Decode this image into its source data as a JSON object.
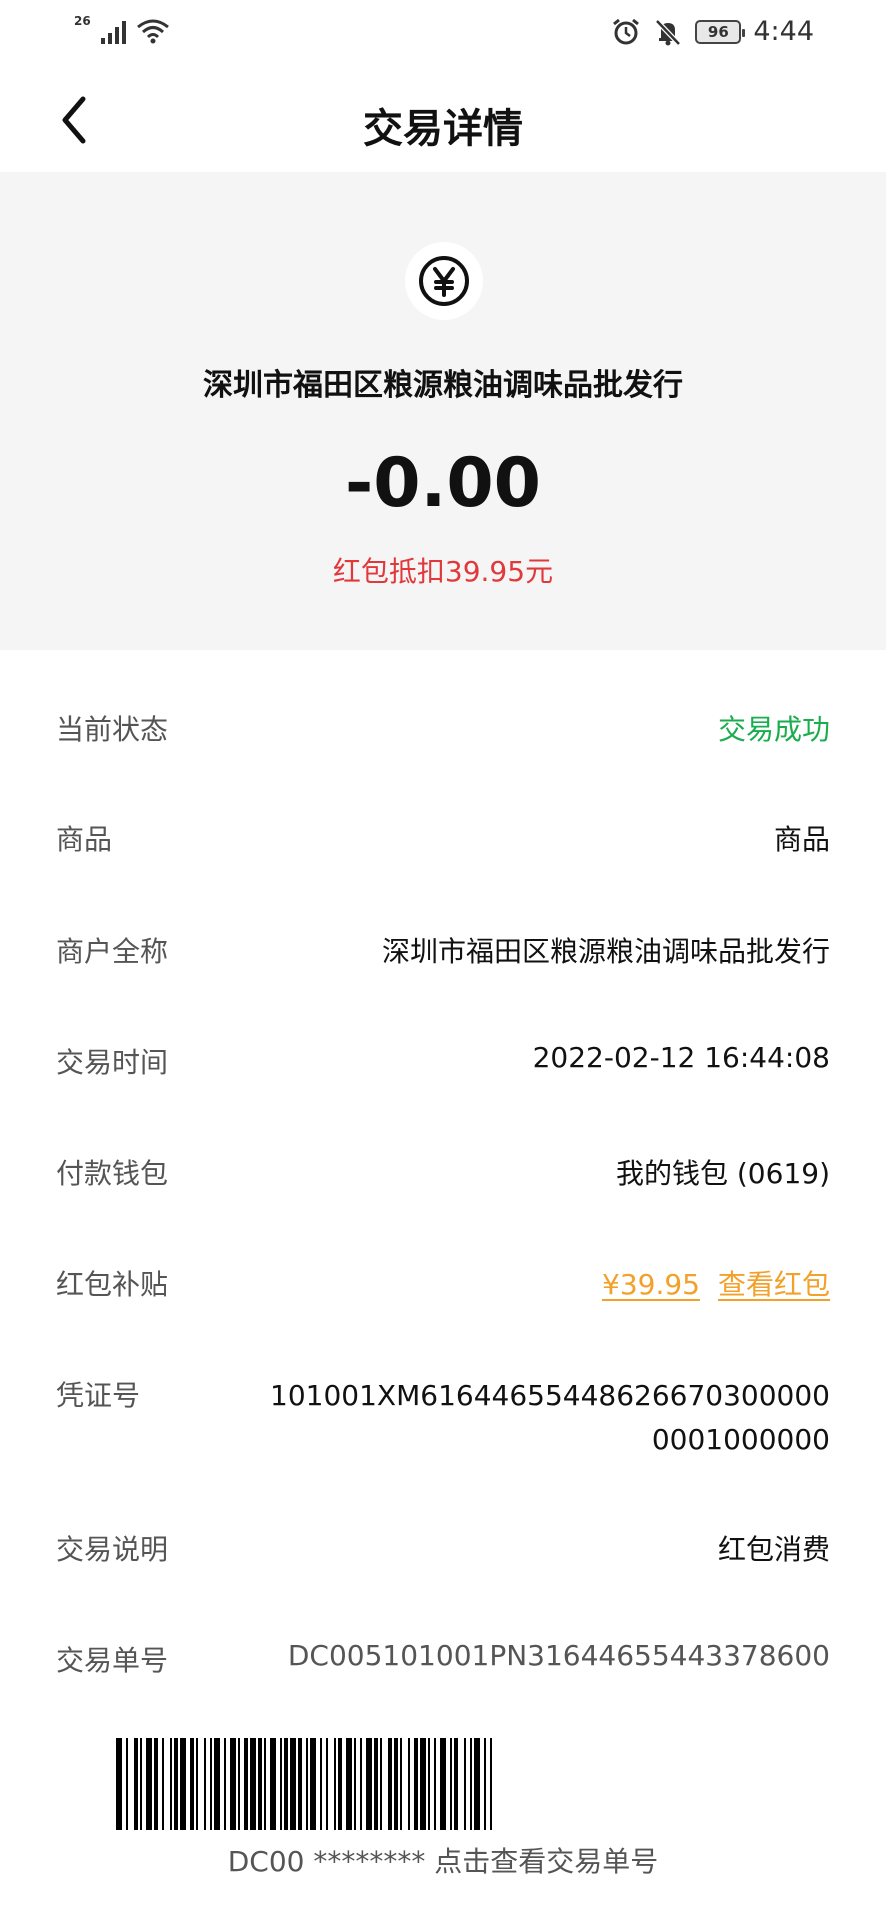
{
  "status_bar": {
    "network": "26",
    "icons": [
      "signal-icon",
      "wifi-icon",
      "alarm-icon",
      "mute-icon"
    ],
    "battery": "96",
    "time": "4:44"
  },
  "nav": {
    "title": "交易详情",
    "back_icon": "back-chevron-icon"
  },
  "header": {
    "icon": "yuan-coin-icon",
    "merchant": "深圳市福田区粮源粮油调味品批发行",
    "amount": "-0.00",
    "deduction": "红包抵扣39.95元"
  },
  "details": [
    {
      "label": "当前状态",
      "value": "交易成功"
    },
    {
      "label": "商品",
      "value": "商品"
    },
    {
      "label": "商户全称",
      "value": "深圳市福田区粮源粮油调味品批发行"
    },
    {
      "label": "交易时间",
      "value": "2022-02-12 16:44:08"
    },
    {
      "label": "付款钱包",
      "value": "我的钱包 (0619)"
    },
    {
      "label": "红包补贴",
      "value": "¥39.95",
      "link": "查看红包"
    },
    {
      "label": "凭证号",
      "value": "101001XM61644655448626670300000 0001000000"
    },
    {
      "label": "交易说明",
      "value": "红包消费"
    },
    {
      "label": "交易单号",
      "value": "DC005101001PN31644655443378600"
    }
  ],
  "barcode": {
    "caption": "DC00 ******** 点击查看交易单号"
  },
  "colors": {
    "success": "#1aad4d",
    "deduction": "#e1393b",
    "link": "#f2a12a",
    "header_bg": "#f5f5f5"
  }
}
